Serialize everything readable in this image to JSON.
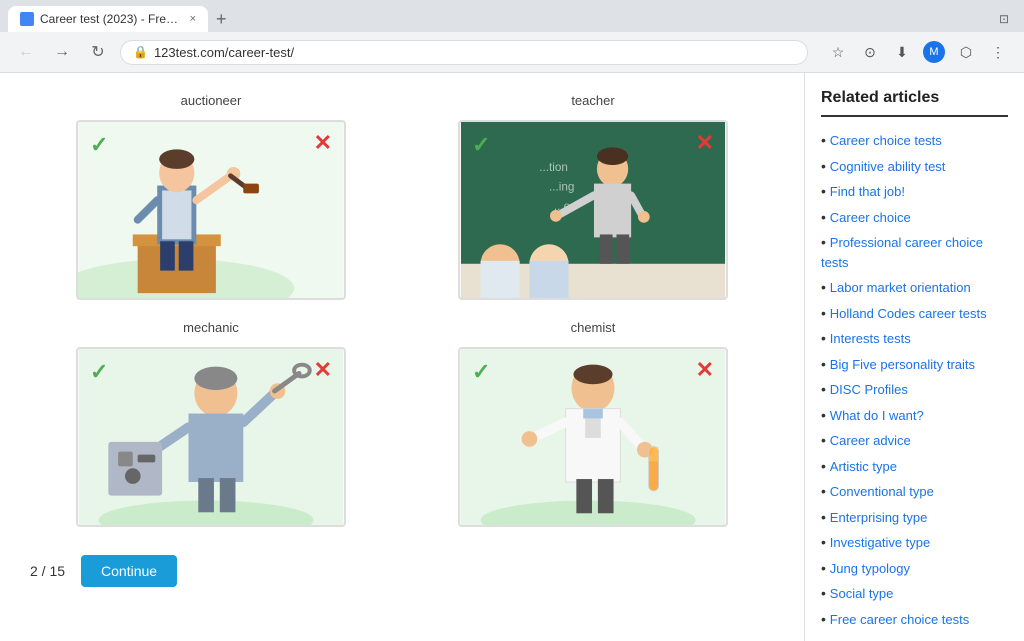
{
  "browser": {
    "tab_title": "Career test (2023) - Free onli...",
    "tab_close": "×",
    "new_tab": "+",
    "nav_back": "←",
    "nav_forward": "→",
    "nav_refresh": "↻",
    "url": "123test.com/career-test/",
    "lock_icon": "🔒"
  },
  "page": {
    "pagination": "2 / 15",
    "continue_label": "Continue"
  },
  "careers": [
    {
      "name": "auctioneer",
      "type": "auctioneer",
      "has_check": true,
      "has_x": true,
      "bg_color": "#e8f5e9"
    },
    {
      "name": "teacher",
      "type": "teacher",
      "has_check": true,
      "has_x": true,
      "bg_color": "#e8f5e9"
    },
    {
      "name": "mechanic",
      "type": "mechanic",
      "has_check": true,
      "has_x": true,
      "bg_color": "#e8f5e9"
    },
    {
      "name": "chemist",
      "type": "chemist",
      "has_check": true,
      "has_x": true,
      "bg_color": "#e8f5e9"
    }
  ],
  "sidebar": {
    "title": "Related articles",
    "items": [
      {
        "label": "Career choice tests",
        "href": "#"
      },
      {
        "label": "Cognitive ability test",
        "href": "#"
      },
      {
        "label": "Find that job!",
        "href": "#"
      },
      {
        "label": "Career choice",
        "href": "#"
      },
      {
        "label": "Professional career choice tests",
        "href": "#"
      },
      {
        "label": "Labor market orientation",
        "href": "#"
      },
      {
        "label": "Holland Codes career tests",
        "href": "#"
      },
      {
        "label": "Interests tests",
        "href": "#"
      },
      {
        "label": "Big Five personality traits",
        "href": "#"
      },
      {
        "label": "DISC Profiles",
        "href": "#"
      },
      {
        "label": "What do I want?",
        "href": "#"
      },
      {
        "label": "Career advice",
        "href": "#"
      },
      {
        "label": "Artistic type",
        "href": "#"
      },
      {
        "label": "Conventional type",
        "href": "#"
      },
      {
        "label": "Enterprising type",
        "href": "#"
      },
      {
        "label": "Investigative type",
        "href": "#"
      },
      {
        "label": "Jung typology",
        "href": "#"
      },
      {
        "label": "Social type",
        "href": "#"
      },
      {
        "label": "Free career choice tests",
        "href": "#"
      }
    ]
  }
}
